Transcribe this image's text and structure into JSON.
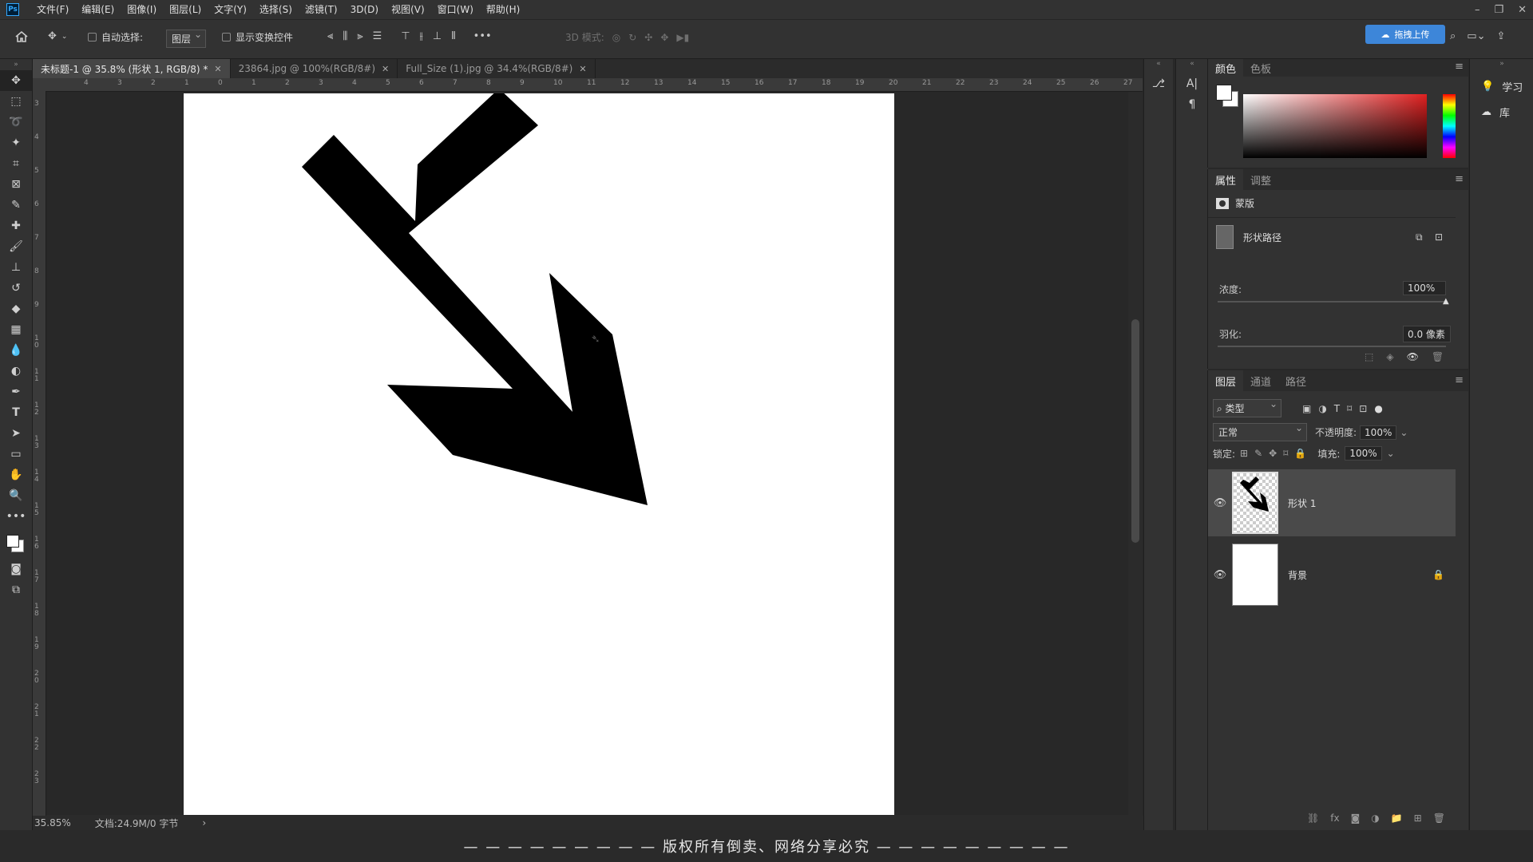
{
  "app": {
    "logo": "Ps"
  },
  "menu": [
    "文件(F)",
    "编辑(E)",
    "图像(I)",
    "图层(L)",
    "文字(Y)",
    "选择(S)",
    "滤镜(T)",
    "3D(D)",
    "视图(V)",
    "窗口(W)",
    "帮助(H)"
  ],
  "window_controls": {
    "minimize": "–",
    "restore": "❐",
    "close": "✕"
  },
  "options": {
    "auto_select_label": "自动选择:",
    "auto_select_value": "图层",
    "show_transform_label": "显示变换控件",
    "mode_3d_label": "3D 模式:",
    "upload_label": "拖拽上传"
  },
  "tabs": [
    {
      "label": "未标题-1 @ 35.8% (形状 1, RGB/8) *",
      "active": true
    },
    {
      "label": "23864.jpg @ 100%(RGB/8#)",
      "active": false
    },
    {
      "label": "Full_Size (1).jpg @ 34.4%(RGB/8#)",
      "active": false
    }
  ],
  "ruler": {
    "h_ticks": [
      "4",
      "3",
      "2",
      "1",
      "0",
      "1",
      "2",
      "3",
      "4",
      "5",
      "6",
      "7",
      "8",
      "9",
      "10",
      "11",
      "12",
      "13",
      "14",
      "15",
      "16",
      "17",
      "18",
      "19",
      "20",
      "21",
      "22",
      "23",
      "24",
      "25",
      "26",
      "27"
    ],
    "v_ticks": [
      "3",
      "4",
      "5",
      "6",
      "7",
      "8",
      "9",
      "10",
      "11",
      "12",
      "13",
      "14",
      "15",
      "16",
      "17",
      "18",
      "19",
      "20",
      "21",
      "22",
      "23"
    ]
  },
  "status": {
    "zoom": "35.85%",
    "doc": "文档:24.9M/0 字节"
  },
  "banner": "— — — — — — — — — 版权所有倒卖、网络分享必究 — — — — — — — — —",
  "color_panel": {
    "tabs": [
      "颜色",
      "色板"
    ]
  },
  "properties_panel": {
    "tabs": [
      "属性",
      "调整"
    ],
    "mask_label": "蒙版",
    "shape_path_label": "形状路径",
    "density_label": "浓度:",
    "density_value": "100%",
    "feather_label": "羽化:",
    "feather_value": "0.0 像素"
  },
  "layers_panel": {
    "tabs": [
      "图层",
      "通道",
      "路径"
    ],
    "filter_label": "类型",
    "blend_mode": "正常",
    "opacity_label": "不透明度:",
    "opacity_value": "100%",
    "lock_label": "锁定:",
    "fill_label": "填充:",
    "fill_value": "100%",
    "layers": [
      {
        "name": "形状 1",
        "selected": true
      },
      {
        "name": "背景",
        "selected": false
      }
    ]
  },
  "learn_panel": {
    "learn": "学习",
    "library": "库"
  },
  "colors": {
    "accent": "#31a8ff",
    "upload_btn": "#3d86d9",
    "panel_bg": "#323232",
    "canvas_bg": "#282828"
  }
}
